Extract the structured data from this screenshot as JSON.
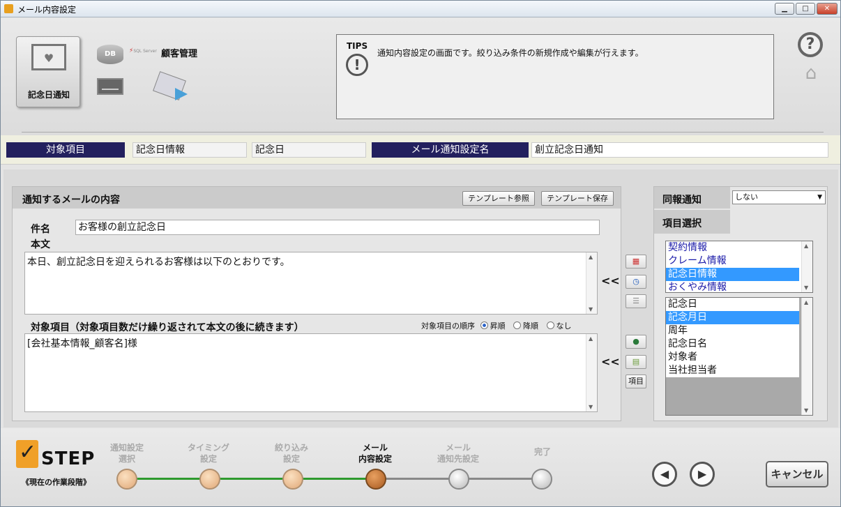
{
  "window": {
    "title": "メール内容設定"
  },
  "top": {
    "selected_label": "記念日通知",
    "db_label": "DB",
    "sql_label": "SQL Server",
    "customer_label": "顧客管理",
    "tips_label": "TIPS",
    "tips_text": "通知内容設定の画面です。絞り込み条件の新規作成や編集が行えます。"
  },
  "infobar": {
    "target_header": "対象項目",
    "target_value1": "記念日情報",
    "target_value2": "記念日",
    "setting_header": "メール通知設定名",
    "setting_value": "創立記念日通知"
  },
  "mail": {
    "panel_title": "通知するメールの内容",
    "template_ref": "テンプレート参照",
    "template_save": "テンプレート保存",
    "subject_label": "件名",
    "subject_value": "お客様の創立記念日",
    "body_label": "本文",
    "body_value": "本日、創立記念日を迎えられるお客様は以下のとおりです。",
    "items_label": "対象項目（対象項目数だけ繰り返されて本文の後に続きます）",
    "order_label": "対象項目の順序",
    "order_options": [
      "昇順",
      "降順",
      "なし"
    ],
    "order_selected": "昇順",
    "items_value": "[会社基本情報_顧客名]様",
    "insert_arrow": "<<",
    "item_button": "項目"
  },
  "right": {
    "dohou_label": "同報通知",
    "dohou_value": "しない",
    "item_select_label": "項目選択",
    "list1": [
      "契約情報",
      "クレーム情報",
      "記念日情報",
      "おくやみ情報"
    ],
    "list1_selected": 2,
    "list2": [
      "記念日",
      "記念月日",
      "周年",
      "記念日名",
      "対象者",
      "当社担当者"
    ],
    "list2_selected": 1
  },
  "steps": {
    "logo_word": "STEP",
    "caption": "《現在の作業段階》",
    "items": [
      {
        "label": "通知設定\n選択",
        "state": "done"
      },
      {
        "label": "タイミング\n設定",
        "state": "done"
      },
      {
        "label": "絞り込み\n設定",
        "state": "done"
      },
      {
        "label": "メール\n内容設定",
        "state": "current"
      },
      {
        "label": "メール\n通知先設定",
        "state": "todo"
      },
      {
        "label": "完了",
        "state": "todo"
      }
    ]
  },
  "footer": {
    "cancel": "キャンセル"
  },
  "colors": {
    "header_navy": "#23205e",
    "selection_blue": "#3399ff",
    "progress_green": "#2e9a2e"
  }
}
